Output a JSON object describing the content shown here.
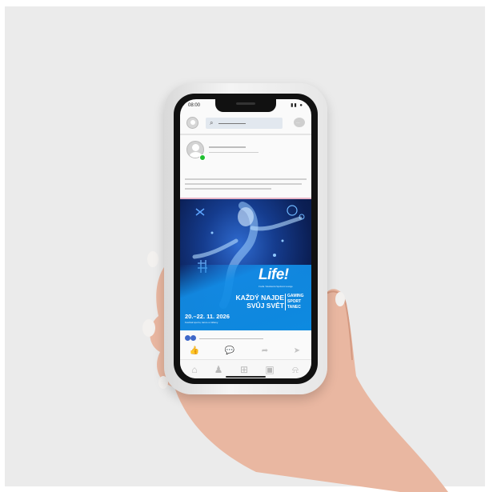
{
  "status_bar": {
    "time": "08:00",
    "indicators": "▮▮ ●"
  },
  "top_bar": {
    "search_icon": "⌕",
    "chat_icon": "…"
  },
  "ad": {
    "logo": "Life!",
    "subtitle": "3 sofa. Všeobecná Sportovní Lounge",
    "headline_line1": "KAŽDÝ NAJDE",
    "headline_line2": "SVŮJ SVĚT",
    "categories": [
      "GAMING",
      "SPORT",
      "TANEC"
    ],
    "date": "20.–22. 11. 2026",
    "date_sub": "Festival sportu, tance a zábavy"
  },
  "actions": {
    "like_icon": "👍",
    "comment_icon": "💬",
    "share_icon": "➦",
    "send_icon": "➤"
  },
  "nav": {
    "home_icon": "⌂",
    "friends_icon": "♟",
    "add_icon": "⊞",
    "shop_icon": "▣",
    "bell_icon": "⍾"
  }
}
